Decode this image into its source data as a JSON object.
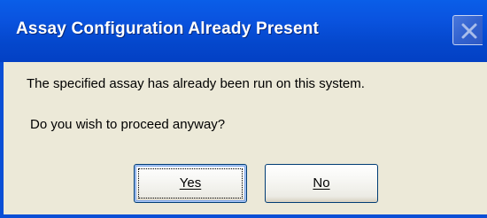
{
  "dialog": {
    "title": "Assay Configuration Already Present",
    "message": "The specified assay has already been run on this system.",
    "question": "Do you wish to proceed anyway?",
    "buttons": {
      "yes_label": "Yes",
      "no_label": "No"
    }
  },
  "icons": {
    "close": "close-icon"
  },
  "colors": {
    "titlebar": "#0a54e0",
    "client_background": "#ece9d8",
    "button_border": "#003c74"
  }
}
